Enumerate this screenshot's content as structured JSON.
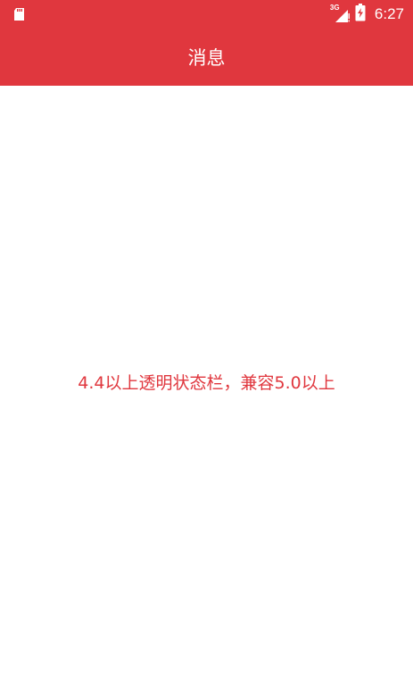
{
  "status_bar": {
    "network_type": "3G",
    "time": "6:27",
    "icons": [
      "sd-card-icon",
      "signal-icon",
      "battery-charging-icon"
    ]
  },
  "app_bar": {
    "title": "消息"
  },
  "main": {
    "message": "4.4以上透明状态栏，兼容5.0以上"
  },
  "colors": {
    "primary": "#e0373e",
    "background": "#ffffff",
    "text_on_primary": "#ffffff"
  }
}
